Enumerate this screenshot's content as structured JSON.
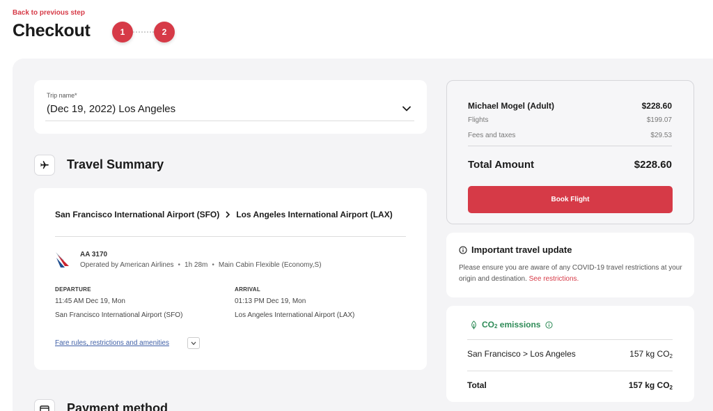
{
  "header": {
    "back_link": "Back to previous step",
    "title": "Checkout",
    "steps": [
      "1",
      "2"
    ]
  },
  "trip": {
    "label": "Trip name*",
    "value": "(Dec 19, 2022) Los Angeles"
  },
  "travel_summary": {
    "title": "Travel Summary",
    "origin": "San Francisco International Airport (SFO)",
    "destination": "Los Angeles International Airport (LAX)",
    "flight_number": "AA 3170",
    "operated_by": "Operated by American Airlines",
    "duration": "1h 28m",
    "cabin": "Main Cabin Flexible (Economy,S)",
    "departure": {
      "label": "DEPARTURE",
      "time": "11:45 AM Dec 19, Mon",
      "airport": "San Francisco International Airport (SFO)"
    },
    "arrival": {
      "label": "ARRIVAL",
      "time": "01:13 PM Dec 19, Mon",
      "airport": "Los Angeles International Airport (LAX)"
    },
    "fare_link": "Fare rules, restrictions and amenities"
  },
  "summary": {
    "passenger": "Michael Mogel (Adult)",
    "passenger_amount": "$228.60",
    "flights_label": "Flights",
    "flights_amount": "$199.07",
    "fees_label": "Fees and taxes",
    "fees_amount": "$29.53",
    "total_label": "Total Amount",
    "total_amount": "$228.60",
    "book_button": "Book Flight"
  },
  "travel_update": {
    "title": "Important travel update",
    "text": "Please ensure you are aware of any COVID-19 travel restrictions at your origin and destination.",
    "link": "See restrictions."
  },
  "co2": {
    "title": "CO",
    "title_sub": "2",
    "title_rest": " emissions",
    "route": "San Francisco > Los Angeles",
    "route_value": "157 kg CO",
    "total_label": "Total",
    "total_value": "157 kg CO",
    "sub": "2"
  },
  "payment": {
    "title": "Payment method"
  },
  "colors": {
    "accent": "#d63a47",
    "co2_green": "#2e8b57",
    "link_blue": "#3f5fa6"
  }
}
